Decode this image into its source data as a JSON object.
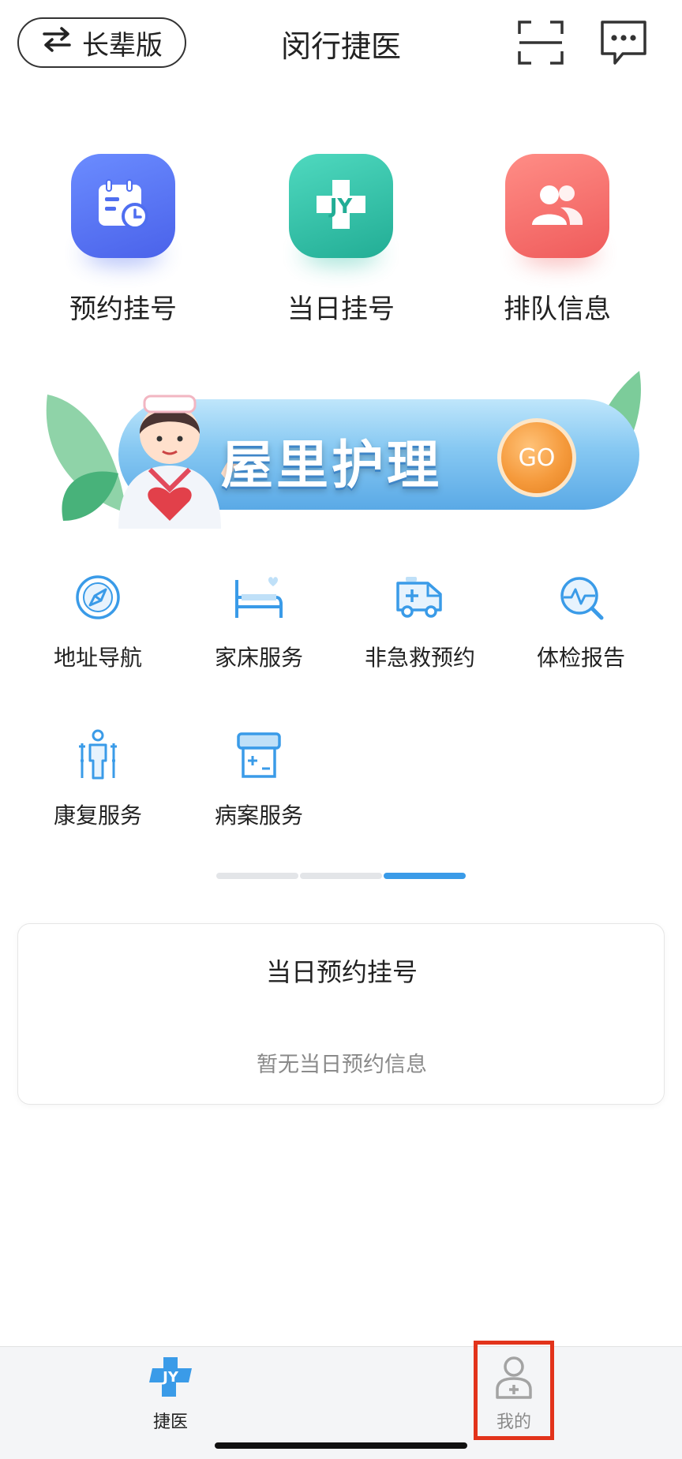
{
  "header": {
    "elder_label": "长辈版",
    "title": "闵行捷医"
  },
  "quick_actions": [
    {
      "label": "预约挂号",
      "icon": "calendar-clock-icon",
      "color": "#4f6ef0"
    },
    {
      "label": "当日挂号",
      "icon": "jy-cross-icon",
      "color": "#2ec0a6"
    },
    {
      "label": "排队信息",
      "icon": "people-icon",
      "color": "#f26b6b"
    }
  ],
  "banner": {
    "text": "屋里护理",
    "go_label": "GO"
  },
  "services": [
    {
      "label": "地址导航",
      "icon": "navigation-compass-icon"
    },
    {
      "label": "家床服务",
      "icon": "home-bed-icon"
    },
    {
      "label": "非急救预约",
      "icon": "ambulance-icon"
    },
    {
      "label": "体检报告",
      "icon": "health-report-icon"
    },
    {
      "label": "康复服务",
      "icon": "rehab-person-icon"
    },
    {
      "label": "病案服务",
      "icon": "medical-record-icon"
    }
  ],
  "pager": {
    "pages": 3,
    "active_index": 2
  },
  "appointment_card": {
    "title": "当日预约挂号",
    "empty_text": "暂无当日预约信息"
  },
  "tabbar": {
    "tabs": [
      {
        "label": "捷医",
        "icon": "jy-logo-icon",
        "active": true
      },
      {
        "label": "我的",
        "icon": "user-medical-icon",
        "active": false
      }
    ]
  },
  "colors": {
    "accent_blue": "#3a9be8",
    "highlight_red": "#e2331b"
  }
}
